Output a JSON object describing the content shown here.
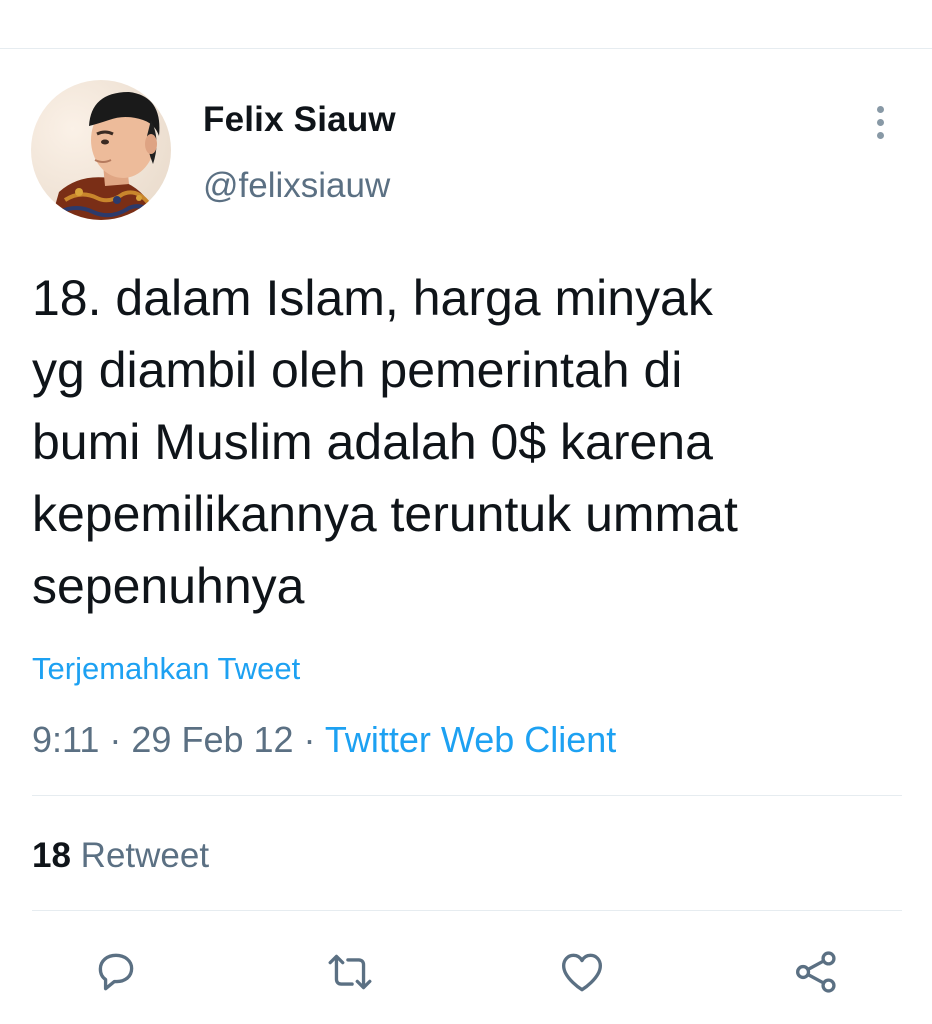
{
  "author": {
    "name": "Felix Siauw",
    "handle": "@felixsiauw"
  },
  "tweet": {
    "text": "18. dalam Islam, harga minyak\nyg diambil oleh pemerintah di\nbumi Muslim adalah 0$ karena\nkepemilikannya teruntuk ummat\nsepenuhnya",
    "translate_label": "Terjemahkan Tweet",
    "time": "9:11",
    "separator1": " · ",
    "date": "29 Feb 12",
    "separator2": " · ",
    "source": "Twitter Web Client"
  },
  "stats": {
    "retweet_count": "18",
    "retweet_label": " Retweet"
  },
  "icons": {
    "more": "more-vertical-icon",
    "reply": "reply-icon",
    "retweet": "retweet-icon",
    "like": "heart-icon",
    "share": "share-icon"
  },
  "colors": {
    "accent": "#1da1f2",
    "secondary_text": "#5b7083",
    "icon": "#5b7083",
    "divider": "#e6ecf0"
  }
}
